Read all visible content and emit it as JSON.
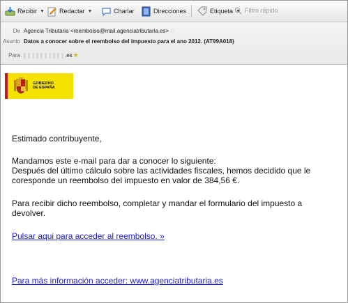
{
  "toolbar": {
    "receive": "Recibir",
    "compose": "Redactar",
    "chat": "Charlar",
    "addresses": "Direcciones",
    "tag": "Etiqueta",
    "quick_filter": "Filtro rápido"
  },
  "header": {
    "from_label": "De",
    "from_value": "Agencia Tributaria <reembolso@mail.agenciatributaria.es>",
    "subject_label": "Asunto",
    "subject_value": "Datos a conocer sobre el reembolso del impuesto para el ano 2012. (AT99A018)",
    "to_label": "Para",
    "to_value_suffix": ".es"
  },
  "logo": {
    "line1": "GOBIERNO",
    "line2": "DE ESPAÑA"
  },
  "message": {
    "greeting": "Estimado contribuyente,",
    "p1_line1": "Mandamos este e-mail para dar a conocer lo siguiente:",
    "p1_line2": "Después del último cálculo sobre las actividades fiscales, hemos decidido que le",
    "p1_line3": "coresponde un reembolso del impuesto en valor de 384,56 €.",
    "p2_line1": "Para recibir dicho reembolso, completar y mandar el formulario del impuesto a",
    "p2_line2": "devolver.",
    "link1": "Pulsar aqui para acceder al reembolso. »",
    "link2": "Para más información acceder: www.agenciatributaria.es"
  }
}
